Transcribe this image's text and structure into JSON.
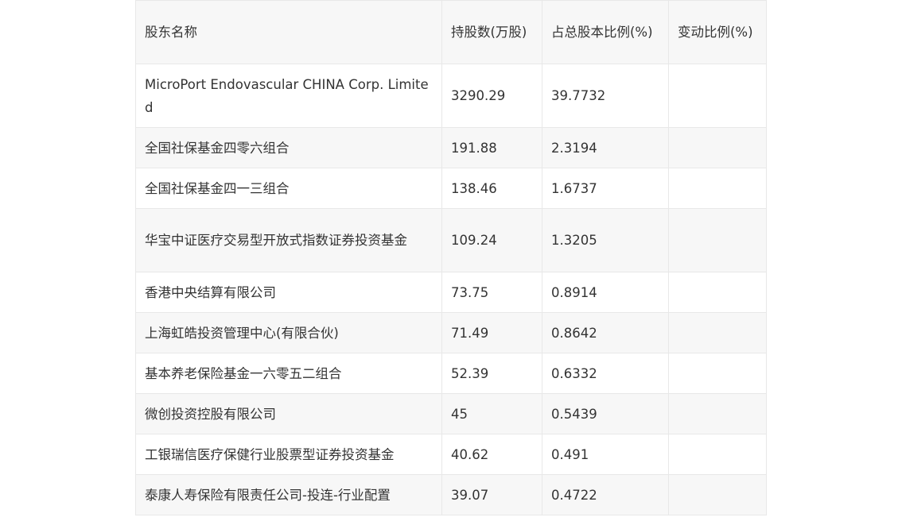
{
  "table": {
    "headers": [
      "股东名称",
      "持股数(万股)",
      "占总股本比例(%)",
      "变动比例(%)"
    ],
    "rows": [
      [
        "MicroPort Endovascular CHINA Corp. Limited",
        "3290.29",
        "39.7732",
        ""
      ],
      [
        "全国社保基金四零六组合",
        "191.88",
        "2.3194",
        ""
      ],
      [
        "全国社保基金四一三组合",
        "138.46",
        "1.6737",
        ""
      ],
      [
        "华宝中证医疗交易型开放式指数证券投资基金",
        "109.24",
        "1.3205",
        ""
      ],
      [
        "香港中央结算有限公司",
        "73.75",
        "0.8914",
        ""
      ],
      [
        "上海虹皓投资管理中心(有限合伙)",
        "71.49",
        "0.8642",
        ""
      ],
      [
        "基本养老保险基金一六零五二组合",
        "52.39",
        "0.6332",
        ""
      ],
      [
        "微创投资控股有限公司",
        "45",
        "0.5439",
        ""
      ],
      [
        "工银瑞信医疗保健行业股票型证券投资基金",
        "40.62",
        "0.491",
        ""
      ],
      [
        "泰康人寿保险有限责任公司-投连-行业配置",
        "39.07",
        "0.4722",
        ""
      ]
    ]
  }
}
